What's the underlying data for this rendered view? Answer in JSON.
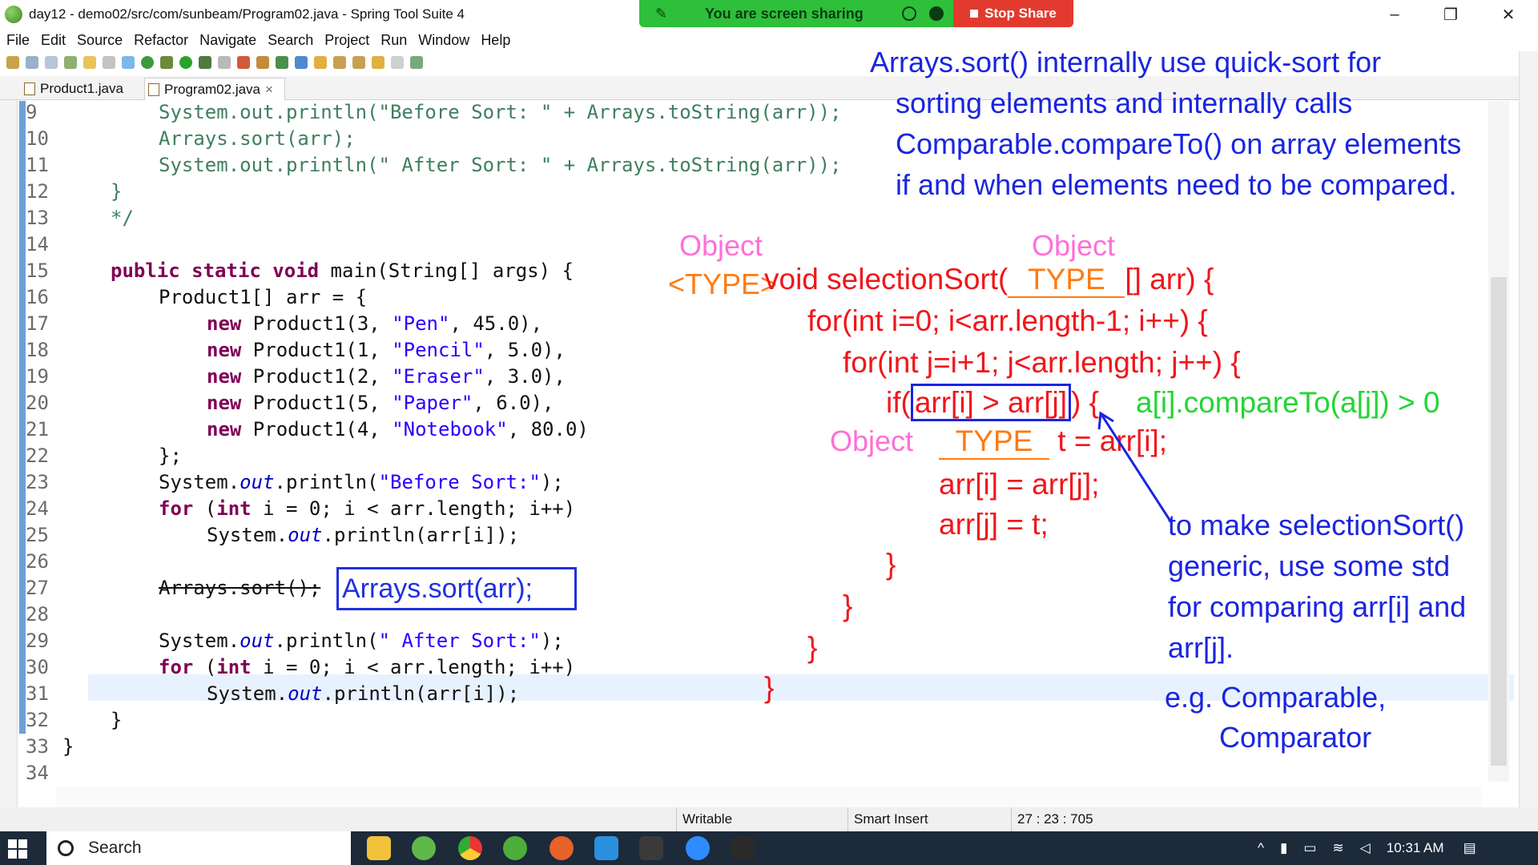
{
  "window": {
    "title": "day12 - demo02/src/com/sunbeam/Program02.java - Spring Tool Suite 4"
  },
  "sharing": {
    "status": "You are screen sharing",
    "stop_label": "Stop Share"
  },
  "menu": [
    "File",
    "Edit",
    "Source",
    "Refactor",
    "Navigate",
    "Search",
    "Project",
    "Run",
    "Window",
    "Help"
  ],
  "tabs": [
    {
      "label": "Product1.java"
    },
    {
      "label": "Program02.java",
      "close": "×"
    }
  ],
  "lines": [
    "9",
    "10",
    "11",
    "12",
    "13",
    "14",
    "15",
    "16",
    "17",
    "18",
    "19",
    "20",
    "21",
    "22",
    "23",
    "24",
    "25",
    "26",
    "27",
    "28",
    "29",
    "30",
    "31",
    "32",
    "33",
    "34"
  ],
  "code": {
    "l9_a": "System.out.println(\"Before Sort: \" + Arrays.toString(arr));",
    "l10": "Arrays.sort(arr);",
    "l11": "System.out.println(\" After Sort: \" + Arrays.toString(arr));",
    "l12": "}",
    "l13": "*/",
    "l15_kw": "public static void",
    "l15_rest": " main(String[] args) {",
    "l16": "Product1[] arr = {",
    "l17_kw": "new",
    "l17_a": " Product1(3, ",
    "l17_s": "\"Pen\"",
    "l17_b": ", 45.0),",
    "l18_kw": "new",
    "l18_a": " Product1(1, ",
    "l18_s": "\"Pencil\"",
    "l18_b": ", 5.0),",
    "l19_kw": "new",
    "l19_a": " Product1(2, ",
    "l19_s": "\"Eraser\"",
    "l19_b": ", 3.0),",
    "l20_kw": "new",
    "l20_a": " Product1(5, ",
    "l20_s": "\"Paper\"",
    "l20_b": ", 6.0),",
    "l21_kw": "new",
    "l21_a": " Product1(4, ",
    "l21_s": "\"Notebook\"",
    "l21_b": ", 80.0)",
    "l22": "};",
    "l23_a": "System.",
    "l23_f": "out",
    "l23_b": ".println(",
    "l23_s": "\"Before Sort:\"",
    "l23_c": ");",
    "l24_kw1": "for",
    "l24_a": " (",
    "l24_kw2": "int",
    "l24_b": " i = 0; i < arr.length; i++)",
    "l25_a": "System.",
    "l25_f": "out",
    "l25_b": ".println(arr[i]);",
    "l27": "Arrays.sort();",
    "l29_a": "System.",
    "l29_f": "out",
    "l29_b": ".println(",
    "l29_s": "\" After Sort:\"",
    "l29_c": ");",
    "l30_kw1": "for",
    "l30_a": " (",
    "l30_kw2": "int",
    "l30_b": " i = 0; i < arr.length; i++)",
    "l31_a": "System.",
    "l31_f": "out",
    "l31_b": ".println(arr[i]);",
    "l32": "}",
    "l33": "}"
  },
  "annotations": {
    "boxed_fix": "Arrays.sort(arr);",
    "note1": [
      "Arrays.sort() internally use quick-sort for",
      "sorting elements and internally calls",
      "Comparable.compareTo() on array elements",
      "if and when elements need to be compared."
    ],
    "object1": "Object",
    "object2": "Object",
    "object3": "Object",
    "type_generic": "<TYPE>",
    "sig_a": "void selectionSort(",
    "sig_type": "TYPE",
    "sig_b": "[] arr) {",
    "for1": "for(int i=0; i<arr.length-1; i++) {",
    "for2": "for(int j=i+1; j<arr.length; j++) {",
    "if_a": "if(",
    "if_cond": "arr[i] > arr[j]",
    "if_b": ") {",
    "compare": "a[i].compareTo(a[j]) > 0",
    "temp_type": "TYPE",
    "temp_rest": "t = arr[i];",
    "assign1": "arr[i] = arr[j];",
    "assign2": "arr[j] = t;",
    "brace1": "}",
    "brace2": "}",
    "brace3": "}",
    "brace4": "}",
    "note2": [
      "to make selectionSort()",
      "generic, use some std",
      "for comparing arr[i] and",
      "arr[j]."
    ],
    "eg1": "e.g. Comparable,",
    "eg2": "Comparator"
  },
  "status": {
    "mode": "Writable",
    "insert": "Smart Insert",
    "position": "27 : 23 : 705"
  },
  "taskbar": {
    "search_placeholder": "Search",
    "time": "10:31 AM"
  },
  "colors": {
    "accent_blue": "#1a25e0",
    "accent_red": "#f0161b",
    "share_green": "#2ec03a",
    "stop_red": "#e23a2e"
  }
}
